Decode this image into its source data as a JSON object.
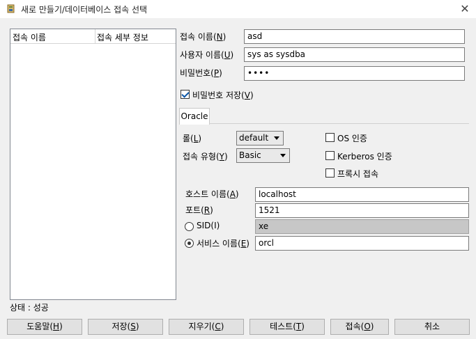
{
  "window": {
    "title": "새로 만들기/데이터베이스 접속 선택",
    "close_glyph": "✕"
  },
  "list": {
    "col_name": "접속 이름",
    "col_detail": "접속 세부 정보"
  },
  "form": {
    "conn_name": {
      "label_pre": "접속 이름(",
      "key": "N",
      "label_post": ")",
      "value": "asd"
    },
    "username": {
      "label_pre": "사용자 이름(",
      "key": "U",
      "label_post": ")",
      "value": "sys as sysdba"
    },
    "password": {
      "label_pre": "비밀번호(",
      "key": "P",
      "label_post": ")",
      "value": "••••"
    },
    "save_password": {
      "label_pre": "비밀번호 저장(",
      "key": "V",
      "label_post": ")",
      "checked": true
    }
  },
  "tab": {
    "label": "Oracle"
  },
  "oracle": {
    "role": {
      "label_pre": "롤(",
      "key": "L",
      "label_post": ")",
      "value": "default"
    },
    "conn_type": {
      "label_pre": "접속 유형(",
      "key": "Y",
      "label_post": ")",
      "value": "Basic"
    },
    "os_auth": {
      "label": "OS 인증",
      "checked": false
    },
    "kerberos": {
      "label": "Kerberos 인증",
      "checked": false
    },
    "proxy": {
      "label": "프록시 접속",
      "checked": false
    },
    "host": {
      "label_pre": "호스트 이름(",
      "key": "A",
      "label_post": ")",
      "value": "localhost"
    },
    "port": {
      "label_pre": "포트(",
      "key": "R",
      "label_post": ")",
      "value": "1521"
    },
    "sid": {
      "label_pre": "S",
      "key": "I",
      "label_mid": "D(",
      "label_post": ")",
      "label": "SID(I)",
      "value": "xe",
      "selected": false
    },
    "service": {
      "label_pre": "서비스 이름(",
      "key": "E",
      "label_post": ")",
      "value": "orcl",
      "selected": true
    }
  },
  "status": {
    "text": "상태 : 성공"
  },
  "buttons": {
    "help": {
      "pre": "도움말(",
      "key": "H",
      "post": ")"
    },
    "save": {
      "pre": "저장(",
      "key": "S",
      "post": ")"
    },
    "clear": {
      "pre": "지우기(",
      "key": "C",
      "post": ")"
    },
    "test": {
      "pre": "테스트(",
      "key": "T",
      "post": ")"
    },
    "connect": {
      "pre": "접속(",
      "key": "O",
      "post": ")"
    },
    "cancel": {
      "label": "취소"
    }
  }
}
